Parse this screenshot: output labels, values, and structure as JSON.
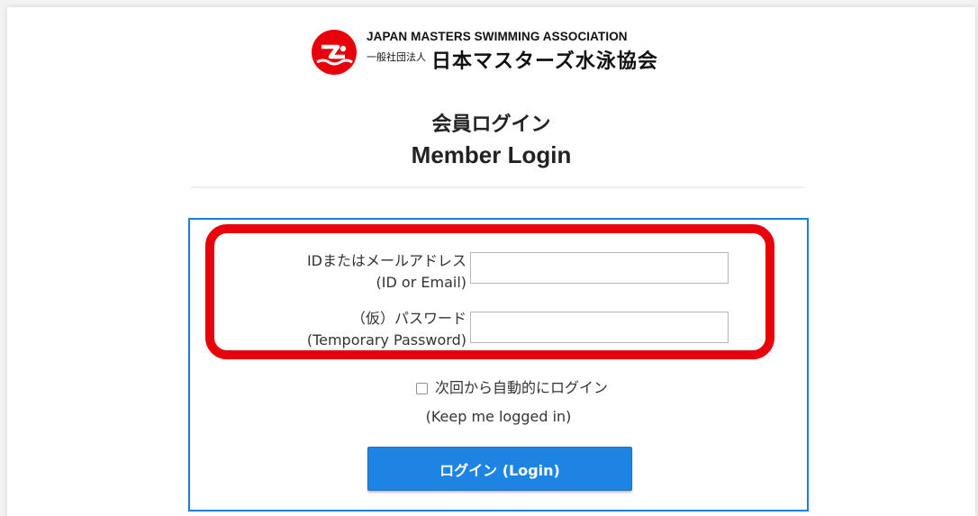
{
  "header": {
    "org_name_en": "JAPAN MASTERS SWIMMING ASSOCIATION",
    "org_prefix_jp": "一般社団法人",
    "org_name_jp": "日本マスターズ水泳協会",
    "logo_icon": "swimmer-logo-icon",
    "logo_color": "#e8000b"
  },
  "title": {
    "jp": "会員ログイン",
    "en": "Member Login"
  },
  "form": {
    "id_label_jp": "IDまたはメールアドレス",
    "id_label_en": "(ID or Email)",
    "id_value": "",
    "password_label_jp": "（仮）パスワード",
    "password_label_en": "(Temporary Password)",
    "password_value": "",
    "remember_label_jp": "次回から自動的にログイン",
    "remember_label_en": "(Keep me logged in)",
    "remember_checked": false,
    "login_button_label": "ログイン (Login)"
  },
  "colors": {
    "accent_blue": "#1b7ddc",
    "button_blue": "#1e84e4",
    "highlight_red": "#e8000b"
  }
}
